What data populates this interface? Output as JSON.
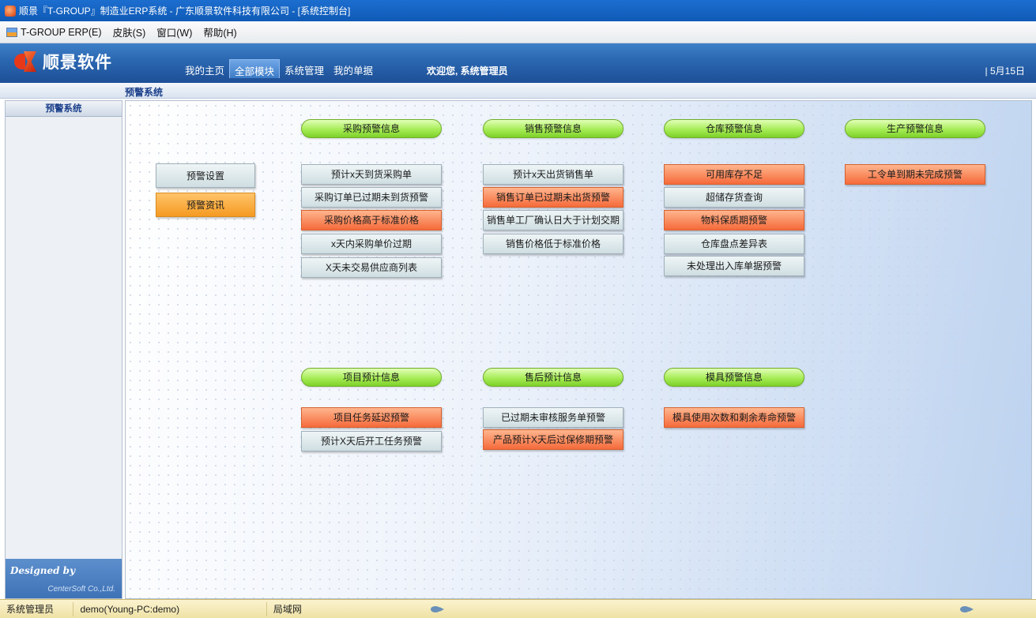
{
  "window": {
    "title": "顺景『T-GROUP』制造业ERP系统 - 广东顺景软件科技有限公司 - [系统控制台]"
  },
  "menu": {
    "items": [
      "T-GROUP ERP(E)",
      "皮肤(S)",
      "窗口(W)",
      "帮助(H)"
    ]
  },
  "header": {
    "logo_text": "顺景软件",
    "tabs": [
      "我的主页",
      "全部模块",
      "系统管理",
      "我的单据"
    ],
    "active_tab": "全部模块",
    "welcome": "欢迎您, 系统管理员",
    "date": "| 5月15日"
  },
  "section": {
    "title": "预警系统"
  },
  "sidebar": {
    "header": "预警系统",
    "designed_by": "Designed by",
    "company": "CenterSoft Co.,Ltd."
  },
  "left_buttons": {
    "settings": "预警设置",
    "news": "预警资讯"
  },
  "groups": {
    "purchase": {
      "title": "采购预警信息",
      "items": [
        "预计x天到货采购单",
        "采购订单已过期未到货预警",
        "采购价格高于标准价格",
        "x天内采购单价过期",
        "X天未交易供应商列表"
      ]
    },
    "sales": {
      "title": "销售预警信息",
      "items": [
        "预计x天出货销售单",
        "销售订单已过期未出货预警",
        "销售单工厂确认日大于计划交期",
        "销售价格低于标准价格"
      ]
    },
    "warehouse": {
      "title": "仓库预警信息",
      "items": [
        "可用库存不足",
        "超储存货查询",
        "物料保质期预警",
        "仓库盘点差异表",
        "未处理出入库单据预警"
      ]
    },
    "production": {
      "title": "生产预警信息",
      "items": [
        "工令单到期未完成预警"
      ]
    },
    "project": {
      "title": "项目预计信息",
      "items": [
        "项目任务延迟预警",
        "预计X天后开工任务预警"
      ]
    },
    "aftersales": {
      "title": "售后预计信息",
      "items": [
        "已过期未审核服务单预警",
        "产品预计X天后过保修期预警"
      ]
    },
    "mold": {
      "title": "模具预警信息",
      "items": [
        "模具使用次数和剩余寿命预警"
      ]
    }
  },
  "status": {
    "user": "系统管理员",
    "account": "demo(Young-PC:demo)",
    "network": "局域网"
  },
  "colors": {
    "header": "#2a66b0",
    "pill_green": "#a6ec56",
    "alert_red": "#f56a3a",
    "orange": "#f59a22"
  }
}
